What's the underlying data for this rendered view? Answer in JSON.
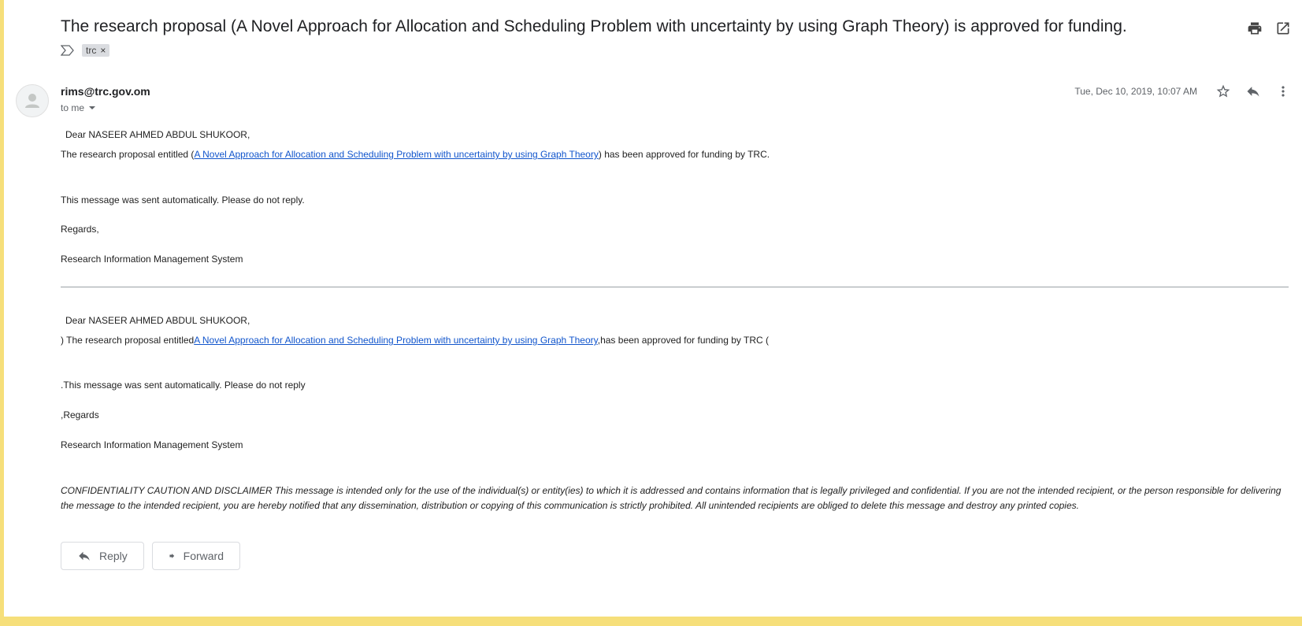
{
  "email": {
    "subject": "The research proposal (A Novel Approach for Allocation and Scheduling Problem with uncertainty by using Graph Theory) is approved for funding.",
    "label_chip": "trc",
    "label_chip_remove": "×",
    "sender": "rims@trc.gov.om",
    "recipient": "to me",
    "date": "Tue, Dec 10, 2019, 10:07 AM"
  },
  "body_en": {
    "greeting": "Dear NASEER AHMED ABDUL SHUKOOR,",
    "line1_prefix": "The research proposal entitled (",
    "link_text": "A Novel Approach for Allocation and Scheduling Problem with uncertainty by using Graph Theory",
    "line1_suffix": ") has been approved for funding by TRC.",
    "auto_note": "This message was sent automatically. Please do not reply.",
    "regards": "Regards,",
    "signature": "Research Information Management System"
  },
  "body_rtl": {
    "greeting": "Dear NASEER AHMED ABDUL SHUKOOR,",
    "line1_prefix": ") The research proposal entitled",
    "link_text": "A Novel Approach for Allocation and Scheduling Problem with uncertainty by using Graph Theory",
    "line1_suffix": ",has been approved for funding by TRC (",
    "auto_note": ".This message was sent automatically. Please do not reply",
    "regards": ",Regards",
    "signature": "Research Information Management System"
  },
  "disclaimer": "CONFIDENTIALITY CAUTION AND DISCLAIMER This message is intended only for the use of the individual(s) or entity(ies) to which it is addressed and contains information that is legally privileged and confidential. If you are not the intended recipient, or the person responsible for delivering the message to the intended recipient, you are hereby notified that any dissemination, distribution or copying of this communication is strictly prohibited. All unintended recipients are obliged to delete this message and destroy any printed copies.",
  "buttons": {
    "reply": "Reply",
    "forward": "Forward"
  },
  "icons": {
    "label": "label-icon",
    "print": "print-icon",
    "open_new_window": "open-in-new-window-icon",
    "star": "star-icon",
    "reply": "reply-icon",
    "more": "more-vertical-icon",
    "forward": "forward-icon",
    "avatar": "default-avatar-icon"
  }
}
